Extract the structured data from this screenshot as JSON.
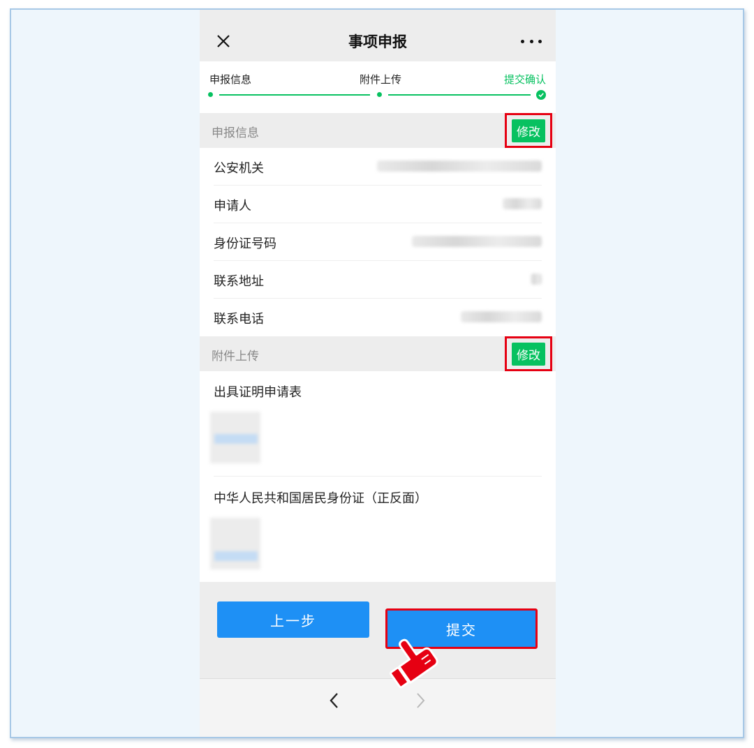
{
  "header": {
    "title": "事项申报"
  },
  "steps": [
    {
      "label": "申报信息",
      "state": "done"
    },
    {
      "label": "附件上传",
      "state": "done"
    },
    {
      "label": "提交确认",
      "state": "current"
    }
  ],
  "declaration": {
    "title": "申报信息",
    "edit_label": "修改",
    "fields": [
      {
        "label": "公安机关",
        "value": ""
      },
      {
        "label": "申请人",
        "value": ""
      },
      {
        "label": "身份证号码",
        "value": ""
      },
      {
        "label": "联系地址",
        "value": ""
      },
      {
        "label": "联系电话",
        "value": ""
      }
    ]
  },
  "attachments": {
    "title": "附件上传",
    "edit_label": "修改",
    "items": [
      {
        "label": "出具证明申请表"
      },
      {
        "label": "中华人民共和国居民身份证（正反面）"
      }
    ]
  },
  "actions": {
    "prev_label": "上一步",
    "submit_label": "提交"
  },
  "colors": {
    "accent": "#07c160",
    "primary_button": "#1e90f5",
    "highlight": "#e60012"
  },
  "icons": [
    "close-icon",
    "more-icon",
    "check-icon",
    "back-arrow-icon",
    "forward-arrow-icon",
    "pointing-hand-icon"
  ]
}
